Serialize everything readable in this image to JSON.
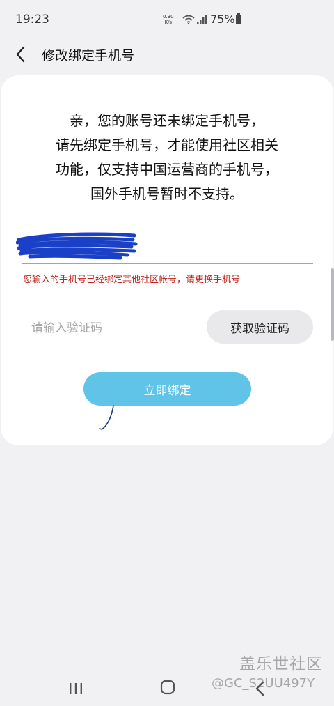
{
  "status_bar": {
    "time": "19:23",
    "net_speed_value": "0.30",
    "net_speed_unit": "K/s",
    "battery": "75%",
    "icons": [
      "wifi-icon",
      "signal-icon",
      "battery-icon"
    ]
  },
  "header": {
    "back_icon": "chevron-left-icon",
    "title": "修改绑定手机号"
  },
  "notice": {
    "lines": [
      "亲，您的账号还未绑定手机号，",
      "请先绑定手机号，才能使用社区相关",
      "功能，仅支持中国运营商的手机号，",
      "国外手机号暂时不支持。"
    ]
  },
  "phone_field": {
    "value_redacted": true,
    "error": "您输入的手机号已经绑定其他社区帐号，请更换手机号"
  },
  "code_field": {
    "placeholder": "请输入验证码",
    "value": "",
    "get_code_label": "获取验证码"
  },
  "bind_button": {
    "label": "立即绑定"
  },
  "watermark": {
    "logo": "盖乐世社区",
    "user": "@GC_S2UU497Y"
  },
  "nav_bar": {
    "icons": [
      "recent-apps-icon",
      "home-icon",
      "back-icon"
    ]
  },
  "colors": {
    "background": "#f1f1f3",
    "card": "#ffffff",
    "accent": "#5fc4e8",
    "error": "#c0231c",
    "underline": "#7ab4c2",
    "redaction": "#1b40c8"
  }
}
